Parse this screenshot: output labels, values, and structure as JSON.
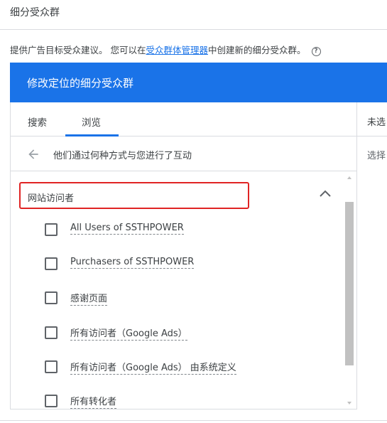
{
  "dialog": {
    "title": "细分受众群"
  },
  "description": {
    "text_before": "提供广告目标受众建议。 您可以在",
    "link": "受众群体管理器",
    "text_after": "中创建新的细分受众群。",
    "help_icon": "help-circle-icon"
  },
  "header": {
    "title": "修改定位的细分受众群",
    "color": "#1a73e8"
  },
  "tabs": [
    {
      "label": "搜索",
      "active": false
    },
    {
      "label": "浏览",
      "active": true
    }
  ],
  "breadcrumb": {
    "back_icon": "arrow-left-icon",
    "label": "他们通过何种方式与您进行了互动"
  },
  "group": {
    "label": "网站访问者",
    "expanded": true,
    "highlight_color": "#e02424"
  },
  "items": [
    {
      "label": "All Users of SSTHPOWER",
      "checked": false
    },
    {
      "label": "Purchasers of SSTHPOWER",
      "checked": false
    },
    {
      "label": "感谢页面",
      "checked": false
    },
    {
      "label": "所有访问者（Google Ads）",
      "checked": false
    },
    {
      "label": "所有访问者（Google Ads） 由系统定义",
      "checked": false
    },
    {
      "label": "所有转化者",
      "checked": false
    }
  ],
  "right_panel": {
    "title": "未选",
    "subtitle": "选择"
  }
}
